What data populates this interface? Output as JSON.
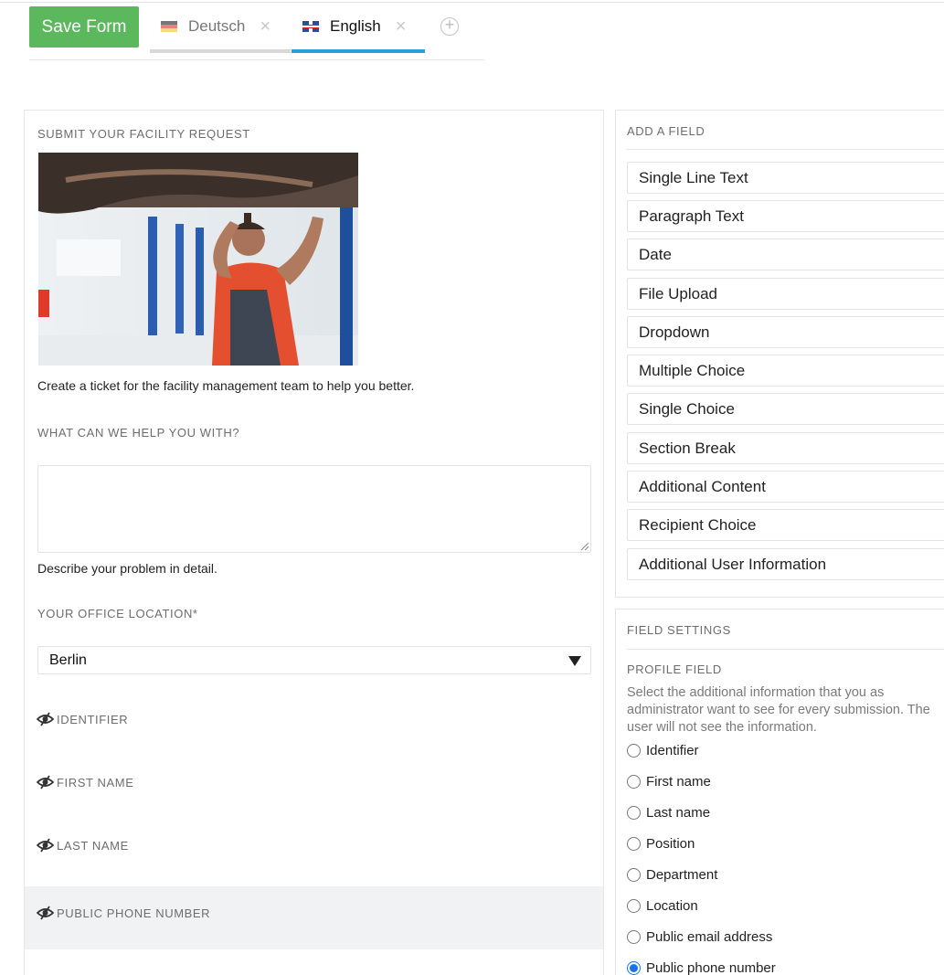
{
  "toolbar": {
    "save_label": "Save Form",
    "add_tab_symbol": "+"
  },
  "tabs": [
    {
      "label": "Deutsch",
      "flag": "de-flag-icon",
      "active": false
    },
    {
      "label": "English",
      "flag": "uk-flag-icon",
      "active": true
    }
  ],
  "colors": {
    "save": "#5cb85c",
    "active_tab": "#2a9fdb",
    "radio_selected": "#1a73e8"
  },
  "form": {
    "title": "SUBMIT YOUR FACILITY REQUEST",
    "intro": "Create a ticket for the facility management team to help you better.",
    "question1": {
      "label": "WHAT CAN WE HELP YOU WITH?",
      "value": "",
      "help": "Describe your problem in detail."
    },
    "question2": {
      "label": "YOUR OFFICE LOCATION*",
      "selected": "Berlin"
    },
    "profile_fields": [
      "IDENTIFIER",
      "FIRST NAME",
      "LAST NAME",
      "PUBLIC PHONE NUMBER"
    ]
  },
  "add_field": {
    "title": "ADD A FIELD",
    "items": [
      "Single Line Text",
      "Paragraph Text",
      "Date",
      "File Upload",
      "Dropdown",
      "Multiple Choice",
      "Single Choice",
      "Section Break",
      "Additional Content",
      "Recipient Choice",
      "Additional User Information"
    ]
  },
  "field_settings": {
    "title": "FIELD SETTINGS",
    "profile_label": "PROFILE FIELD",
    "description": "Select the additional information that you as administrator want to see for every submission. The user will not see the information.",
    "options": [
      "Identifier",
      "First name",
      "Last name",
      "Position",
      "Department",
      "Location",
      "Public email address",
      "Public phone number"
    ],
    "selected": "Public phone number"
  }
}
